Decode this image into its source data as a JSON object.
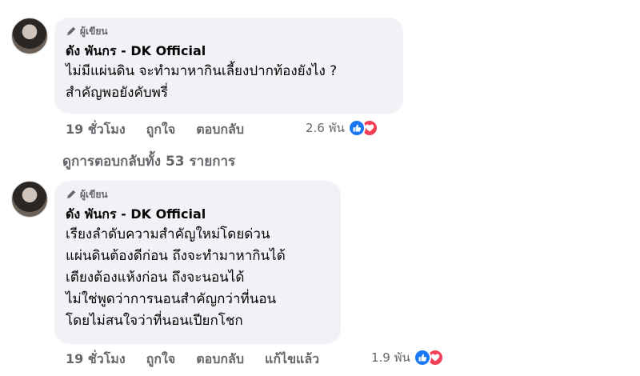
{
  "comments": [
    {
      "badge_label": "ผู้เขียน",
      "author": "ดัง พันกร - DK Official",
      "lines": [
        "ไม่มีแผ่นดิน จะทำมาหากินเลี้ยงปากท้องยังไง ?",
        "สำคัญพอยังคับพรี่"
      ],
      "time": "19 ชั่วโมง",
      "like_label": "ถูกใจ",
      "reply_label": "ตอบกลับ",
      "reaction_count": "2.6 พัน"
    },
    {
      "badge_label": "ผู้เขียน",
      "author": "ดัง พันกร - DK Official",
      "lines": [
        "เรียงลำดับความสำคัญใหม่โดยด่วน",
        "แผ่นดินต้องดีก่อน ถึงจะทำมาหากินได้",
        "เตียงต้องแห้งก่อน ถึงจะนอนได้",
        "ไม่ใช่พูดว่าการนอนสำคัญกว่าที่นอน",
        "โดยไม่สนใจว่าที่นอนเปียกโชก"
      ],
      "time": "19 ชั่วโมง",
      "like_label": "ถูกใจ",
      "reply_label": "ตอบกลับ",
      "edited_label": "แก้ไขแล้ว",
      "reaction_count": "1.9 พัน"
    }
  ],
  "view_replies": "ดูการตอบกลับทั้ง 53 รายการ",
  "colors": {
    "bubble": "#f0f2f5",
    "meta_text": "#65676b",
    "like": "#1877f2",
    "love": "#f33e58"
  },
  "icons": [
    "pen-icon",
    "like-reaction-icon",
    "love-reaction-icon"
  ]
}
